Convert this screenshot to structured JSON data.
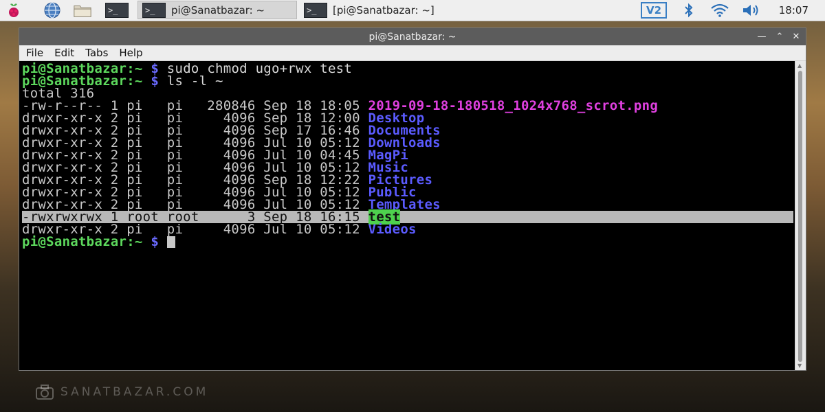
{
  "taskbar": {
    "icons": [
      "raspberry-menu-icon",
      "globe-browser-icon",
      "folder-icon",
      "terminal-icon"
    ],
    "tasks": [
      {
        "label": "pi@Sanatbazar: ~",
        "active": true
      },
      {
        "label": "[pi@Sanatbazar: ~]",
        "active": false
      }
    ],
    "tray": [
      "vnc-icon",
      "bluetooth-icon",
      "wifi-icon",
      "volume-icon"
    ],
    "vnc_label": "V2",
    "clock": "18:07"
  },
  "window": {
    "title": "pi@Sanatbazar: ~",
    "menu": [
      "File",
      "Edit",
      "Tabs",
      "Help"
    ]
  },
  "terminal": {
    "prompt": "pi@Sanatbazar:~",
    "dollar": "$",
    "cmd1": "sudo chmod ugo+rwx test",
    "cmd2": "ls -l ~",
    "total": "total 316",
    "rows": [
      {
        "meta": "-rw-r--r-- 1 pi   pi   280846 Sep 18 18:05 ",
        "name": "2019-09-18-180518_1024x768_scrot.png",
        "kind": "img"
      },
      {
        "meta": "drwxr-xr-x 2 pi   pi     4096 Sep 18 12:00 ",
        "name": "Desktop",
        "kind": "dir"
      },
      {
        "meta": "drwxr-xr-x 2 pi   pi     4096 Sep 17 16:46 ",
        "name": "Documents",
        "kind": "dir"
      },
      {
        "meta": "drwxr-xr-x 2 pi   pi     4096 Jul 10 05:12 ",
        "name": "Downloads",
        "kind": "dir"
      },
      {
        "meta": "drwxr-xr-x 2 pi   pi     4096 Jul 10 04:45 ",
        "name": "MagPi",
        "kind": "dir"
      },
      {
        "meta": "drwxr-xr-x 2 pi   pi     4096 Jul 10 05:12 ",
        "name": "Music",
        "kind": "dir"
      },
      {
        "meta": "drwxr-xr-x 2 pi   pi     4096 Sep 18 12:22 ",
        "name": "Pictures",
        "kind": "dir"
      },
      {
        "meta": "drwxr-xr-x 2 pi   pi     4096 Jul 10 05:12 ",
        "name": "Public",
        "kind": "dir"
      },
      {
        "meta": "drwxr-xr-x 2 pi   pi     4096 Jul 10 05:12 ",
        "name": "Templates",
        "kind": "dir"
      },
      {
        "meta": "-rwxrwxrwx 1 root root      3 Sep 18 16:15 ",
        "name": "test",
        "kind": "hl"
      },
      {
        "meta": "drwxr-xr-x 2 pi   pi     4096 Jul 10 05:12 ",
        "name": "Videos",
        "kind": "dir"
      }
    ]
  },
  "watermark": "SANATBAZAR.COM",
  "colors": {
    "prompt_green": "#5dd85d",
    "dir_blue": "#5b5bff",
    "image_magenta": "#e040e0",
    "highlight_green": "#4ed14e"
  }
}
